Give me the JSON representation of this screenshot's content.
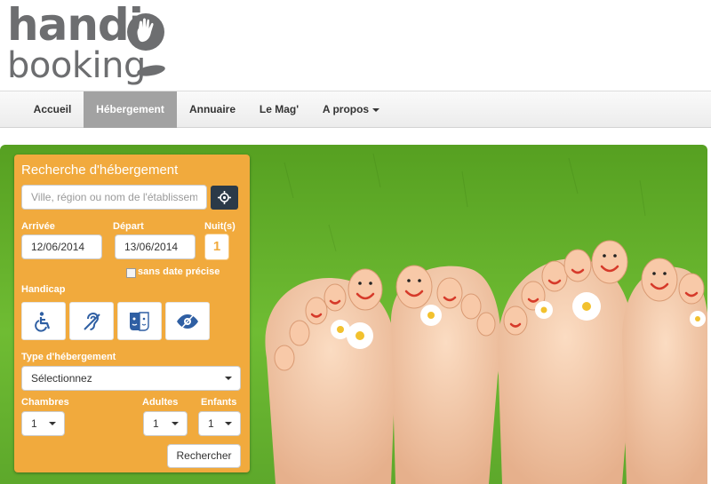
{
  "logo": {
    "line1": "handi",
    "line2": "booking"
  },
  "nav": [
    {
      "label": "Accueil"
    },
    {
      "label": "Hébergement"
    },
    {
      "label": "Annuaire"
    },
    {
      "label": "Le Mag'"
    },
    {
      "label": "A propos"
    }
  ],
  "nav_active_index": 1,
  "search": {
    "title": "Recherche d'hébergement",
    "placeholder": "Ville, région ou nom de l'établissement",
    "arrival_label": "Arrivée",
    "arrival_value": "12/06/2014",
    "departure_label": "Départ",
    "departure_value": "13/06/2014",
    "nights_label": "Nuit(s)",
    "nights_value": "1",
    "no_date_label": "sans date précise",
    "handicap_label": "Handicap",
    "handicap_icons": [
      "wheelchair-icon",
      "hearing-icon",
      "mental-icon",
      "visual-icon"
    ],
    "type_label": "Type d'hébergement",
    "type_value": "Sélectionnez",
    "rooms_label": "Chambres",
    "rooms_value": "1",
    "adults_label": "Adultes",
    "adults_value": "1",
    "children_label": "Enfants",
    "children_value": "1",
    "submit_label": "Rechercher"
  },
  "colors": {
    "panel": "#f1aa3d",
    "accent_icon": "#2f5fa3",
    "logo_gray": "#6d6e70",
    "nav_active": "#a2a2a2",
    "grass": "#6fbc33"
  }
}
